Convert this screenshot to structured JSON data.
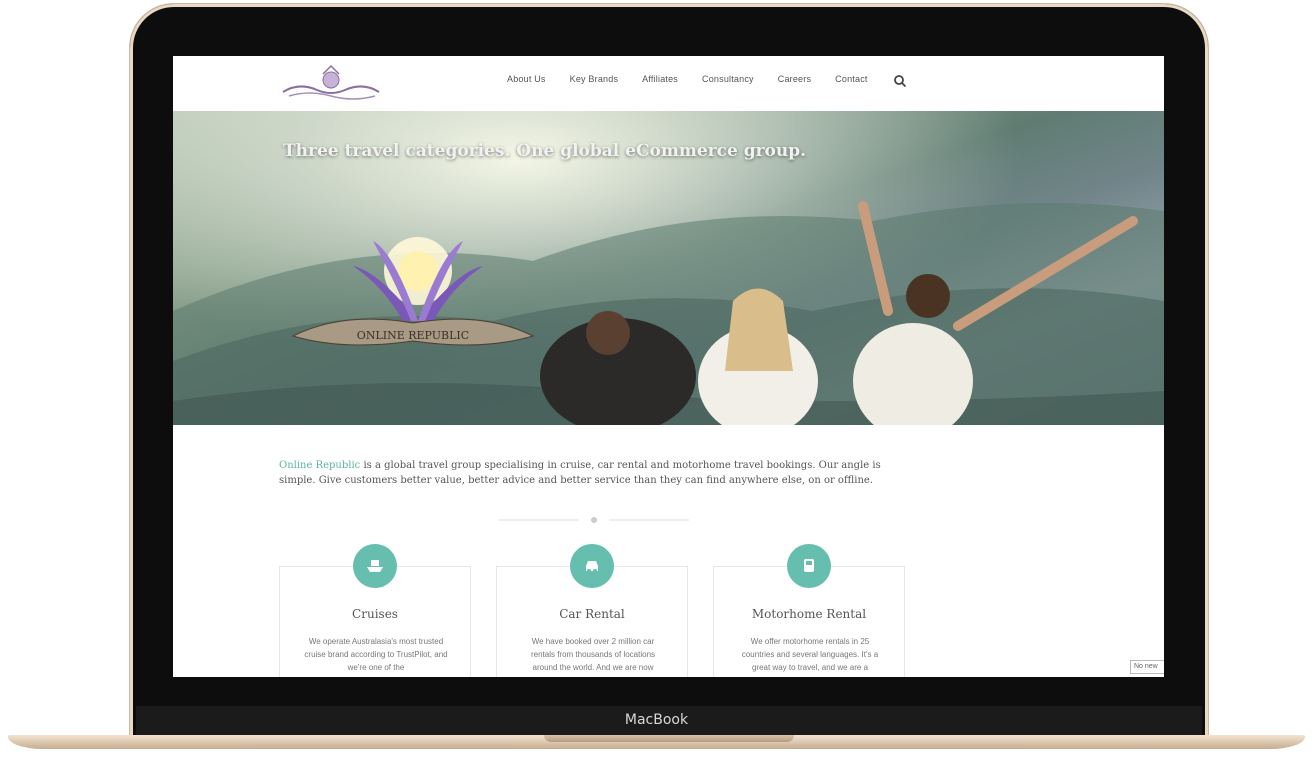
{
  "device": {
    "label": "MacBook"
  },
  "site": {
    "nav": [
      "About Us",
      "Key Brands",
      "Affiliates",
      "Consultancy",
      "Careers",
      "Contact"
    ],
    "hero_title": "Three travel categories. One global eCommerce group.",
    "intro_link": "Online Republic",
    "intro_rest": " is a global travel group specialising in cruise, car rental and motorhome travel bookings. Our angle is simple. Give customers better value, better advice and better service than they can find anywhere else, on or offline.",
    "cards": [
      {
        "title": "Cruises",
        "text": "We operate Australasia's most trusted cruise brand according to TrustPilot, and we're one of the",
        "icon": "ship-icon"
      },
      {
        "title": "Car Rental",
        "text": "We have booked over 2 million car rentals from thousands of locations around the world. And we are now",
        "icon": "car-icon"
      },
      {
        "title": "Motorhome Rental",
        "text": "We offer motorhome rentals in 25 countries and several languages. It's a great way to travel, and we are a",
        "icon": "bus-icon"
      }
    ],
    "corner_tag": "No new"
  },
  "colors": {
    "accent": "#66bfae",
    "link": "#5bb5a6",
    "frame": "#0d0d0d",
    "gold": "#e9d8c3"
  }
}
